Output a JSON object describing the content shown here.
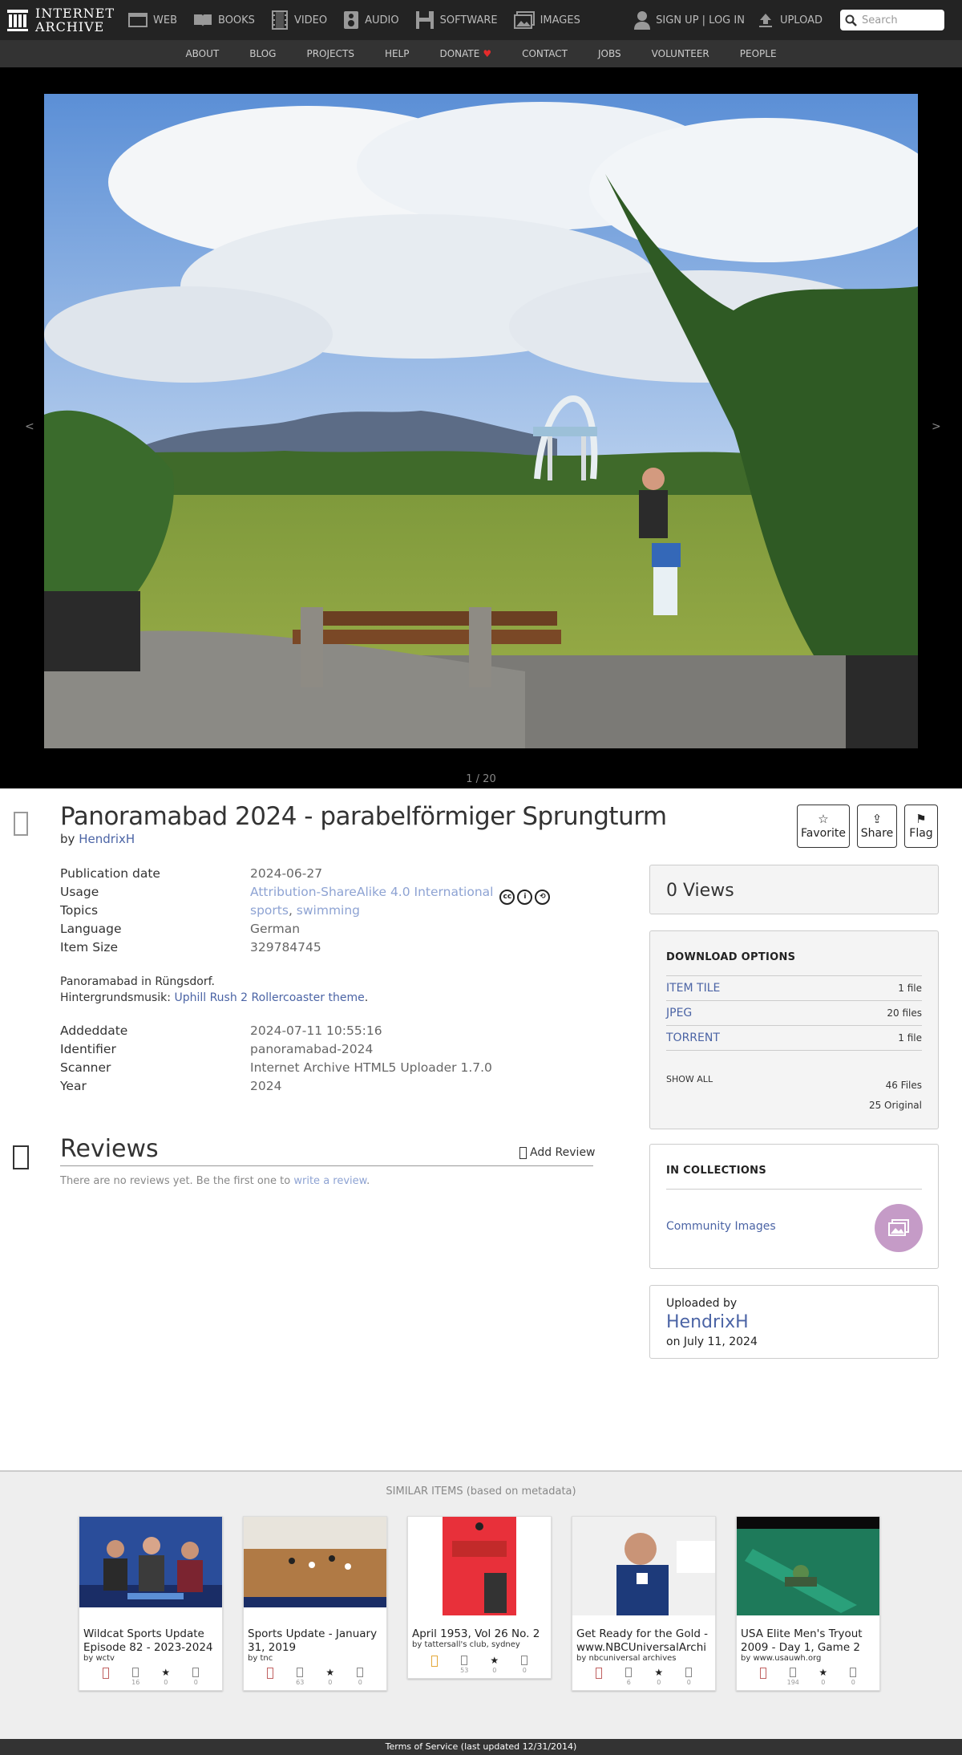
{
  "brand": {
    "line1": "INTERNET",
    "line2": "ARCHIVE"
  },
  "nav": {
    "mediatypes": [
      {
        "label": "WEB",
        "icon": "web-icon"
      },
      {
        "label": "BOOKS",
        "icon": "book-icon"
      },
      {
        "label": "VIDEO",
        "icon": "film-icon"
      },
      {
        "label": "AUDIO",
        "icon": "speaker-icon"
      },
      {
        "label": "SOFTWARE",
        "icon": "floppy-icon"
      },
      {
        "label": "IMAGES",
        "icon": "image-icon"
      }
    ],
    "signup": "SIGN UP | LOG IN",
    "upload": "UPLOAD",
    "search_placeholder": "Search"
  },
  "subnav": [
    "ABOUT",
    "BLOG",
    "PROJECTS",
    "HELP",
    "DONATE",
    "CONTACT",
    "JOBS",
    "VOLUNTEER",
    "PEOPLE"
  ],
  "theater": {
    "counter": "1 / 20",
    "prev": "<",
    "next": ">"
  },
  "item": {
    "title": "Panoramabad 2024 - parabelförmiger Sprungturm",
    "by_prefix": "by",
    "creator": "HendrixH",
    "actions": {
      "favorite": "Favorite",
      "share": "Share",
      "flag": "Flag"
    },
    "metadata": [
      {
        "key": "Publication date",
        "value": "2024-06-27"
      },
      {
        "key": "Usage",
        "value": "Attribution-ShareAlike 4.0 International"
      },
      {
        "key": "Topics",
        "value": "sports, swimming"
      },
      {
        "key": "Language",
        "value": "German"
      },
      {
        "key": "Item Size",
        "value": "329784745"
      }
    ],
    "topics": [
      "sports",
      "swimming"
    ],
    "description_line1": "Panoramabad in Rüngsdorf.",
    "description_prefix": "Hintergrundsmusik:",
    "description_link": "Uphill Rush 2 Rollercoaster theme",
    "description_suffix": ".",
    "metadata2": [
      {
        "key": "Addeddate",
        "value": "2024-07-11 10:55:16"
      },
      {
        "key": "Identifier",
        "value": "panoramabad-2024"
      },
      {
        "key": "Scanner",
        "value": "Internet Archive HTML5 Uploader 1.7.0"
      },
      {
        "key": "Year",
        "value": "2024"
      }
    ]
  },
  "reviews": {
    "title": "Reviews",
    "add_label": "Add Review",
    "empty_prefix": "There are no reviews yet. Be the first one to",
    "empty_link": "write a review",
    "empty_suffix": "."
  },
  "views": "0 Views",
  "downloads": {
    "heading": "DOWNLOAD OPTIONS",
    "options": [
      {
        "name": "ITEM TILE",
        "count": "1 file"
      },
      {
        "name": "JPEG",
        "count": "20 files"
      },
      {
        "name": "TORRENT",
        "count": "1 file"
      }
    ],
    "show_all": "SHOW ALL",
    "total_files": "46 Files",
    "original": "25 Original"
  },
  "collections": {
    "heading": "IN COLLECTIONS",
    "name": "Community Images"
  },
  "uploader": {
    "label": "Uploaded by",
    "name": "HendrixH",
    "date": "on July 11, 2024"
  },
  "similar": {
    "title": "SIMILAR ITEMS (based on metadata)",
    "items": [
      {
        "title": "Wildcat Sports Update Episode 82 - 2023-2024",
        "by": "by wctv",
        "views": "16",
        "favs": "0",
        "reviews": "0"
      },
      {
        "title": "Sports Update - January 31, 2019",
        "by": "by tnc",
        "views": "63",
        "favs": "0",
        "reviews": "0"
      },
      {
        "title": "April 1953, Vol 26 No. 2",
        "by": "by tattersall's club, sydney",
        "views": "53",
        "favs": "0",
        "reviews": "0"
      },
      {
        "title": "Get Ready for the Gold - www.NBCUniversalArchi",
        "by": "by nbcuniversal archives",
        "views": "6",
        "favs": "0",
        "reviews": "0"
      },
      {
        "title": "USA Elite Men's Tryout 2009 - Day 1, Game 2",
        "by": "by www.usauwh.org",
        "views": "194",
        "favs": "0",
        "reviews": "0"
      }
    ]
  },
  "footer": "Terms of Service (last updated 12/31/2014)",
  "colors": {
    "link": "#4b64a5",
    "link_light": "#8ea3d3",
    "nav_bg": "#232323",
    "subnav_bg": "#333333"
  }
}
